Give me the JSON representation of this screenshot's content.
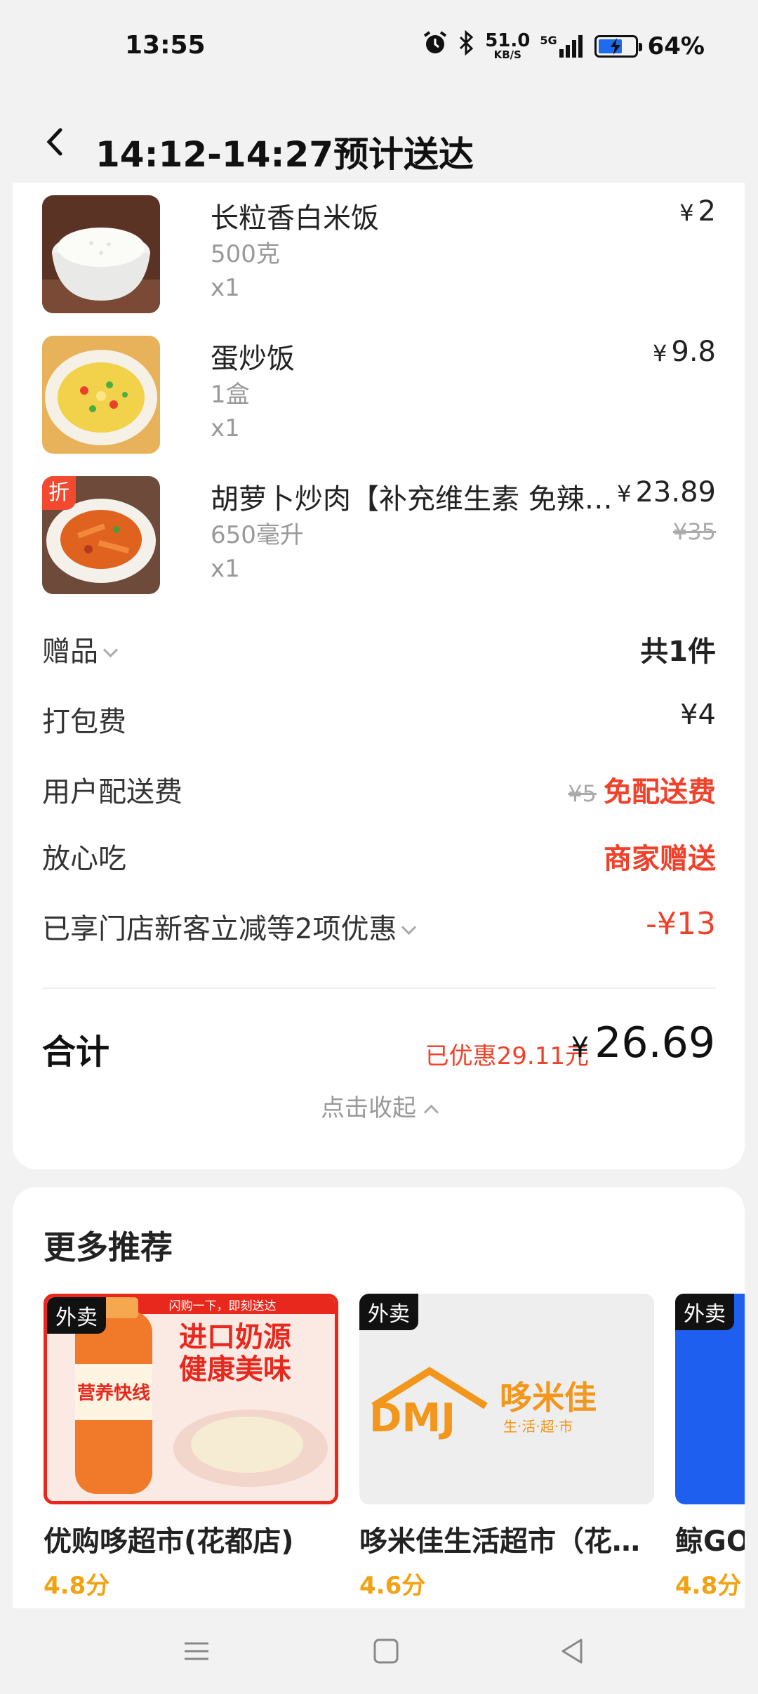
{
  "status_bar": {
    "time": "13:55",
    "net_speed_value": "51.0",
    "net_speed_unit": "KB/S",
    "network": "5G",
    "battery": "64%"
  },
  "header": {
    "title": "14:12-14:27预计送达"
  },
  "items": [
    {
      "name": "长粒香白米饭",
      "spec": "500克",
      "qty": "x1",
      "price": "2",
      "currency": "¥",
      "image": "rice-bowl-image"
    },
    {
      "name": "蛋炒饭",
      "spec": "1盒",
      "qty": "x1",
      "price": "9.8",
      "currency": "¥",
      "image": "egg-fried-rice-image"
    },
    {
      "name": "胡萝卜炒肉【补充维生素 免辣…",
      "spec": "650毫升",
      "qty": "x1",
      "price": "23.89",
      "currency": "¥",
      "original_price": "¥35",
      "badge": "折",
      "image": "carrot-pork-image"
    }
  ],
  "fees": {
    "gift": {
      "label": "赠品",
      "value": "共1件"
    },
    "packing": {
      "label": "打包费",
      "value": "¥4"
    },
    "delivery": {
      "label": "用户配送费",
      "original": "¥5",
      "value": "免配送费"
    },
    "assurance": {
      "label": "放心吃",
      "value": "商家赠送"
    },
    "discount": {
      "label": "已享门店新客立减等2项优惠",
      "value": "-¥13"
    }
  },
  "total": {
    "label": "合计",
    "saved": "已优惠29.11元",
    "currency": "¥",
    "amount": "26.69",
    "collapse_label": "点击收起"
  },
  "recommendations": {
    "title": "更多推荐",
    "items": [
      {
        "tag": "外卖",
        "name": "优购哆超市(花都店)",
        "score": "4.8分",
        "banner_top": "闪购一下，即刻送达",
        "banner_main1": "进口奶源",
        "banner_main2": "健康美味",
        "bottle_text": "营养快线"
      },
      {
        "tag": "外卖",
        "name": "哆米佳生活超市（花…",
        "score": "4.6分",
        "logo_letters": "DMJ",
        "logo_cn": "哆米佳",
        "logo_sub": "生·活·超·市"
      },
      {
        "tag": "外卖",
        "name": "鲸GO",
        "score": "4.8分"
      }
    ]
  },
  "colors": {
    "accent_red": "#f0412b",
    "score_orange": "#f2a213",
    "logo_orange": "#f2961c"
  }
}
